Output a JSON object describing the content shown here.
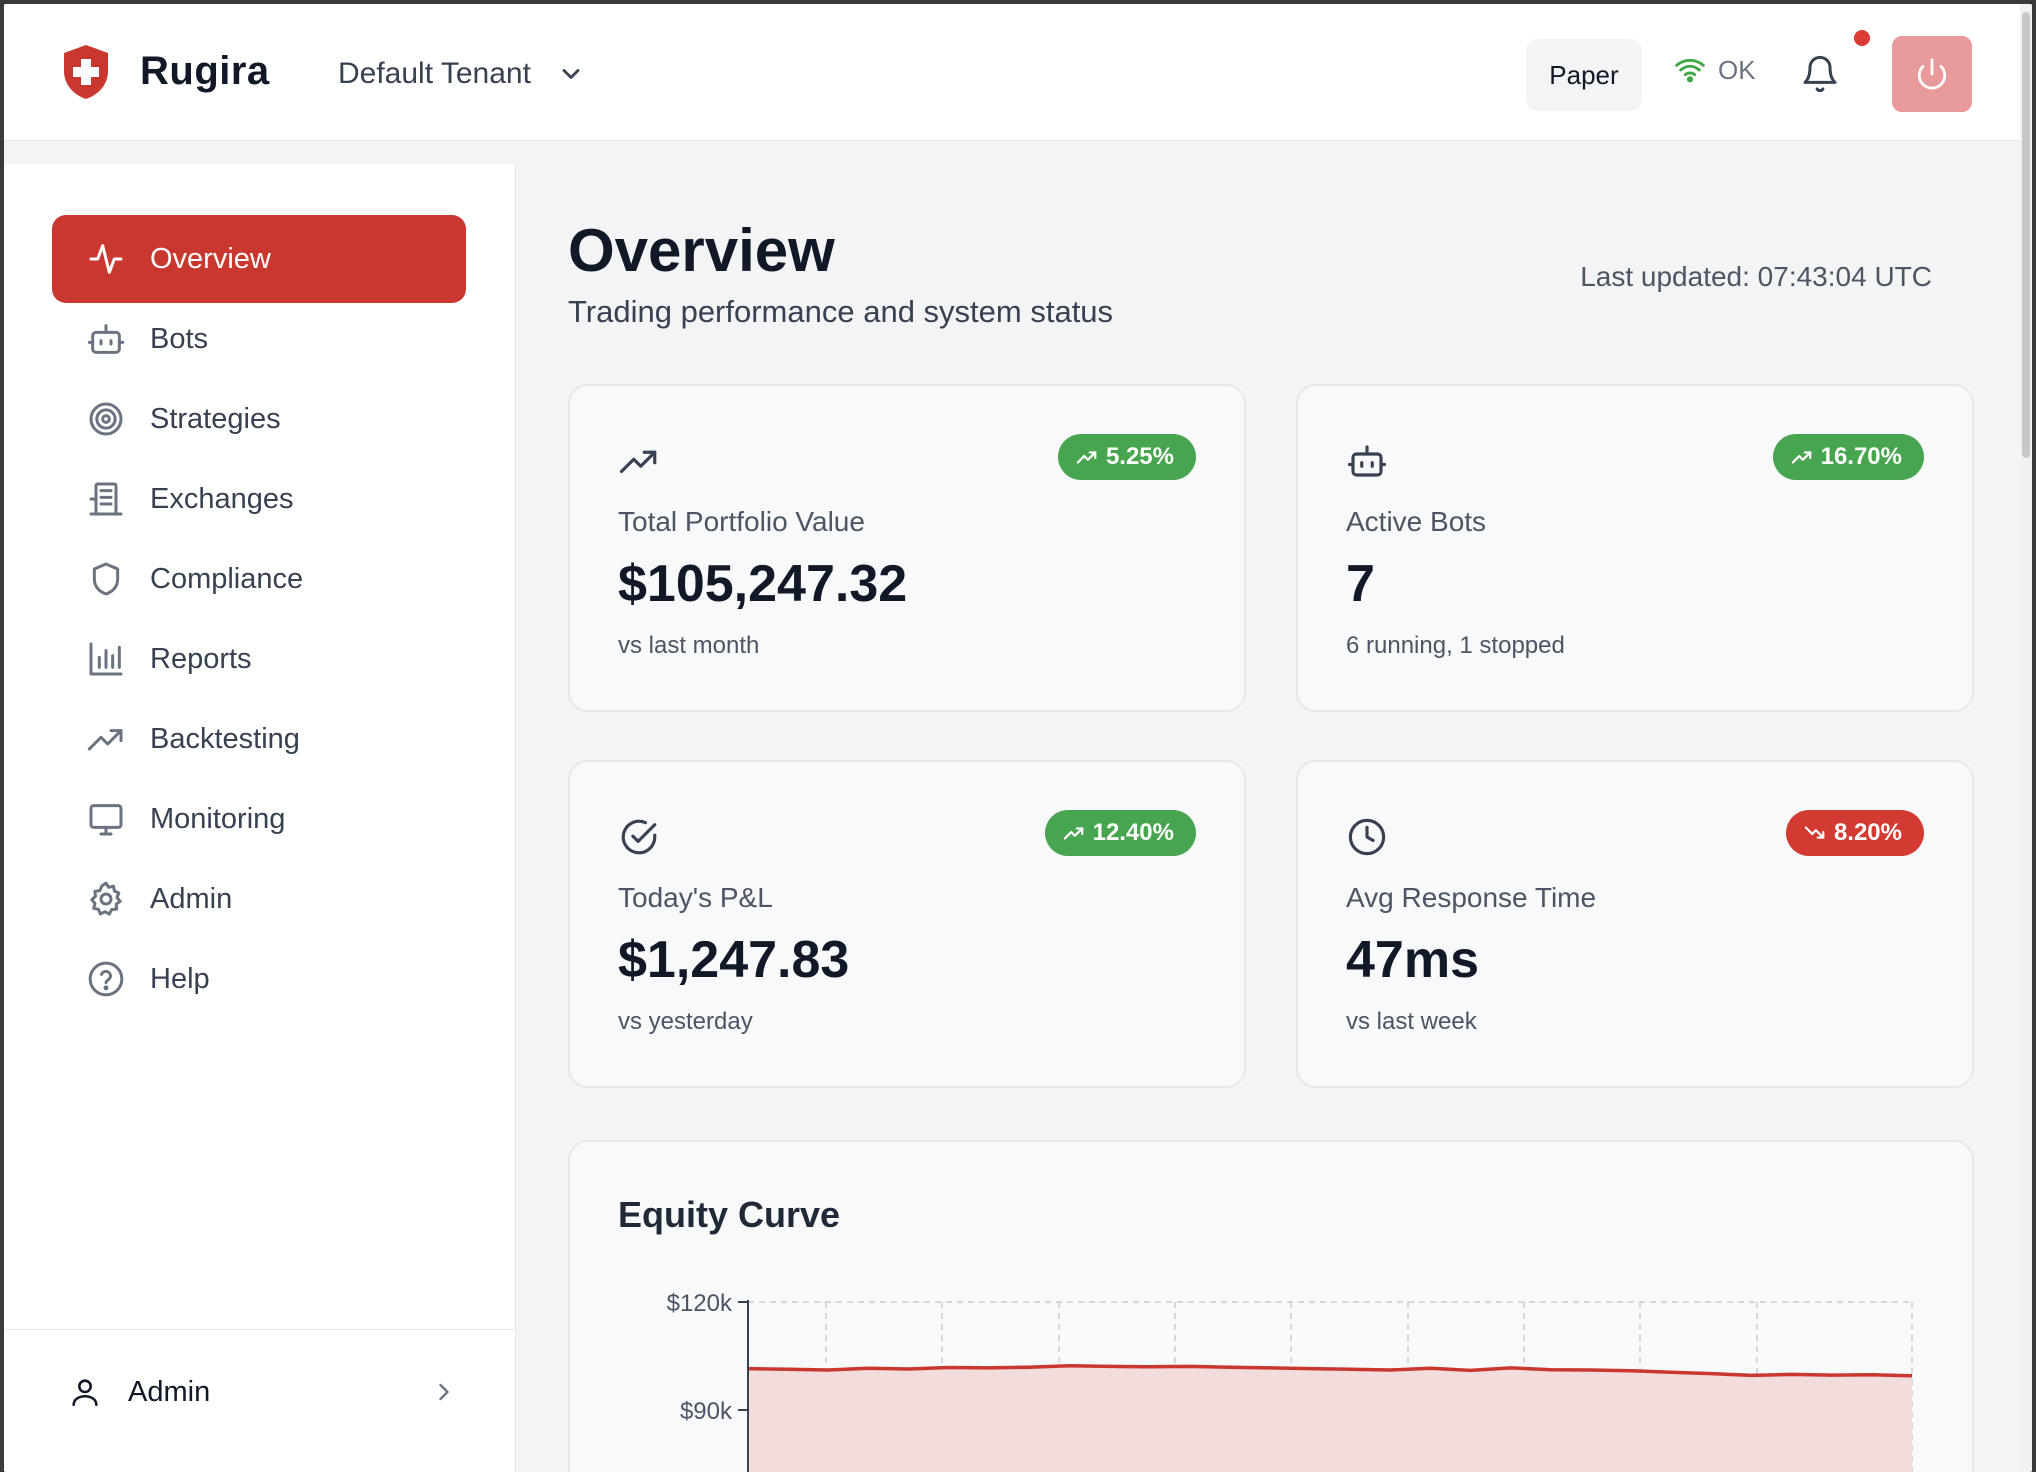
{
  "header": {
    "brand": "Rugira",
    "tenant": "Default Tenant",
    "mode": "Paper",
    "status": "OK",
    "has_notification": true,
    "colors": {
      "accent": "#c9372f",
      "success": "#47a54f",
      "danger": "#d33a31"
    }
  },
  "sidebar": {
    "items": [
      {
        "label": "Overview",
        "icon": "activity-icon",
        "active": true
      },
      {
        "label": "Bots",
        "icon": "bot-icon",
        "active": false
      },
      {
        "label": "Strategies",
        "icon": "target-icon",
        "active": false
      },
      {
        "label": "Exchanges",
        "icon": "building-icon",
        "active": false
      },
      {
        "label": "Compliance",
        "icon": "shield-icon",
        "active": false
      },
      {
        "label": "Reports",
        "icon": "bar-chart-icon",
        "active": false
      },
      {
        "label": "Backtesting",
        "icon": "trending-up-icon",
        "active": false
      },
      {
        "label": "Monitoring",
        "icon": "monitor-icon",
        "active": false
      },
      {
        "label": "Admin",
        "icon": "gear-icon",
        "active": false
      },
      {
        "label": "Help",
        "icon": "help-icon",
        "active": false
      }
    ],
    "user": {
      "name": "Admin"
    }
  },
  "main": {
    "title": "Overview",
    "subtitle": "Trading performance and system status",
    "last_updated": "Last updated: 07:43:04 UTC",
    "cards": [
      {
        "label": "Total Portfolio Value",
        "value": "$105,247.32",
        "sub": "vs last month",
        "change": "5.25%",
        "direction": "up",
        "icon": "trending-up-icon"
      },
      {
        "label": "Active Bots",
        "value": "7",
        "sub": "6 running, 1 stopped",
        "change": "16.70%",
        "direction": "up",
        "icon": "bot-icon"
      },
      {
        "label": "Today's P&L",
        "value": "$1,247.83",
        "sub": "vs yesterday",
        "change": "12.40%",
        "direction": "up",
        "icon": "check-circle-icon"
      },
      {
        "label": "Avg Response Time",
        "value": "47ms",
        "sub": "vs last week",
        "change": "8.20%",
        "direction": "down",
        "icon": "clock-icon"
      }
    ],
    "equity": {
      "title": "Equity Curve"
    }
  },
  "chart_data": {
    "type": "area",
    "title": "Equity Curve",
    "ylim": [
      0,
      120000
    ],
    "ytick_labels": [
      "$120k",
      "$90k"
    ],
    "yticks": [
      120000,
      90000
    ],
    "grid": true,
    "series": [
      {
        "values": [
          101500,
          101300,
          101100,
          101600,
          101400,
          101800,
          101700,
          101900,
          102300,
          102100,
          102000,
          102100,
          101900,
          101700,
          101500,
          101300,
          101100,
          101600,
          101000,
          101700,
          101200,
          101100,
          100900,
          100500,
          100100,
          99600,
          99900,
          99700,
          99800,
          99500
        ]
      }
    ]
  }
}
